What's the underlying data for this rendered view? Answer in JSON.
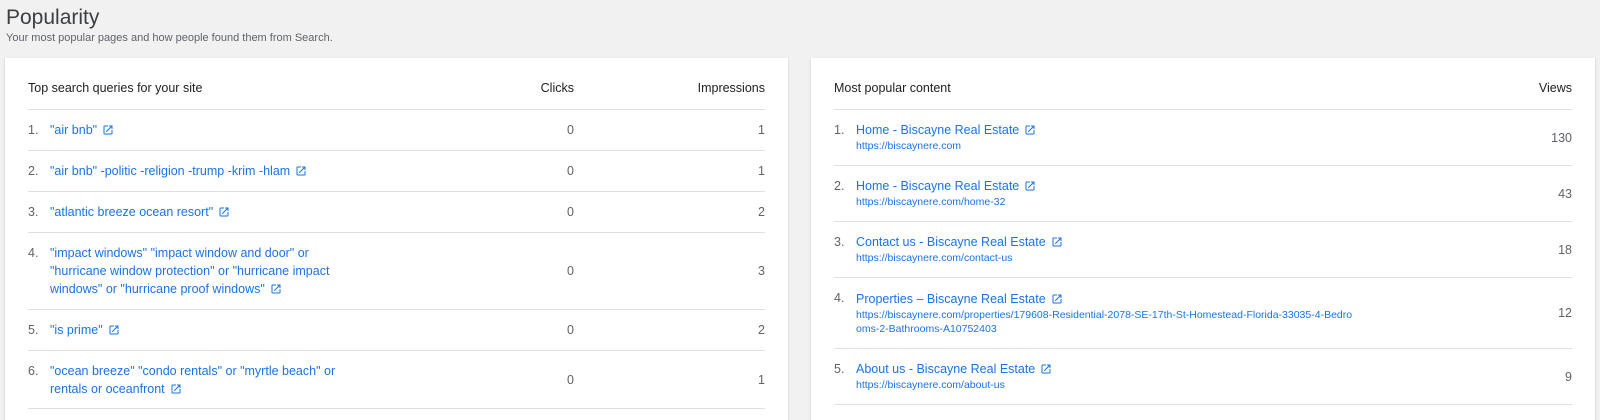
{
  "page": {
    "title": "Popularity",
    "subtitle": "Your most popular pages and how people found them from Search."
  },
  "queries": {
    "header": "Top search queries for your site",
    "clicks_header": "Clicks",
    "impressions_header": "Impressions",
    "rows": [
      {
        "num": "1.",
        "query": "\"air bnb\"",
        "clicks": "0",
        "impressions": "1"
      },
      {
        "num": "2.",
        "query": "\"air bnb\" -politic -religion -trump -krim -hlam",
        "clicks": "0",
        "impressions": "1"
      },
      {
        "num": "3.",
        "query": "\"atlantic breeze ocean resort\"",
        "clicks": "0",
        "impressions": "2"
      },
      {
        "num": "4.",
        "query": "\"impact windows\" \"impact window and door\" or \"hurricane window protection\" or \"hurricane impact windows\" or \"hurricane proof windows\"",
        "clicks": "0",
        "impressions": "3"
      },
      {
        "num": "5.",
        "query": "\"is prime\"",
        "clicks": "0",
        "impressions": "2"
      },
      {
        "num": "6.",
        "query": "\"ocean breeze\" \"condo rentals\" or \"myrtle beach\" or rentals or oceanfront",
        "clicks": "0",
        "impressions": "1"
      }
    ]
  },
  "content": {
    "header": "Most popular content",
    "views_header": "Views",
    "rows": [
      {
        "num": "1.",
        "title": "Home - Biscayne Real Estate",
        "url": "https://biscaynere.com",
        "views": "130"
      },
      {
        "num": "2.",
        "title": "Home - Biscayne Real Estate",
        "url": "https://biscaynere.com/home-32",
        "views": "43"
      },
      {
        "num": "3.",
        "title": "Contact us - Biscayne Real Estate",
        "url": "https://biscaynere.com/contact-us",
        "views": "18"
      },
      {
        "num": "4.",
        "title": "Properties – Biscayne Real Estate",
        "url": "https://biscaynere.com/properties/179608-Residential-2078-SE-17th-St-Homestead-Florida-33035-4-Bedrooms-2-Bathrooms-A10752403",
        "views": "12"
      },
      {
        "num": "5.",
        "title": "About us - Biscayne Real Estate",
        "url": "https://biscaynere.com/about-us",
        "views": "9"
      }
    ]
  },
  "icons": {
    "external_link": "open-in-new-icon"
  },
  "colors": {
    "link": "#1a73e8",
    "background": "#f1f1f1"
  }
}
